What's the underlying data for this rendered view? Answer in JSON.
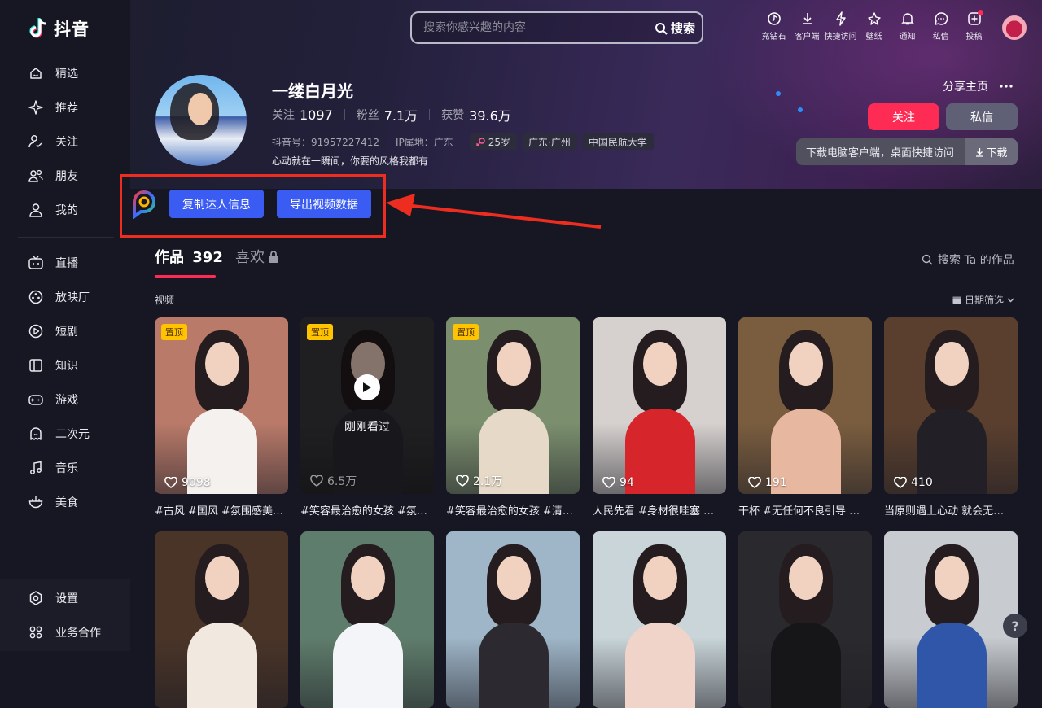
{
  "app": {
    "logo_text": "抖音"
  },
  "sidebar": {
    "items": [
      {
        "label": "精选",
        "icon": "home-smile-icon"
      },
      {
        "label": "推荐",
        "icon": "sparkle-icon"
      },
      {
        "label": "关注",
        "icon": "user-check-icon"
      },
      {
        "label": "朋友",
        "icon": "friends-icon"
      },
      {
        "label": "我的",
        "icon": "person-icon"
      }
    ],
    "items2": [
      {
        "label": "直播",
        "icon": "tv-icon"
      },
      {
        "label": "放映厅",
        "icon": "film-reel-icon"
      },
      {
        "label": "短剧",
        "icon": "play-circle-icon"
      },
      {
        "label": "知识",
        "icon": "book-icon"
      },
      {
        "label": "游戏",
        "icon": "gamepad-icon"
      },
      {
        "label": "二次元",
        "icon": "ghost-icon"
      },
      {
        "label": "音乐",
        "icon": "music-note-icon"
      },
      {
        "label": "美食",
        "icon": "bowl-icon"
      }
    ],
    "bottom": [
      {
        "label": "设置",
        "icon": "settings-icon"
      },
      {
        "label": "业务合作",
        "icon": "grid-icon"
      }
    ]
  },
  "header": {
    "search_placeholder": "搜索你感兴趣的内容",
    "search_button": "搜索",
    "actions": [
      {
        "label": "充钻石",
        "icon": "diamond-icon"
      },
      {
        "label": "客户端",
        "icon": "download-icon"
      },
      {
        "label": "快捷访问",
        "icon": "lightning-icon"
      },
      {
        "label": "壁纸",
        "icon": "star-sparkle-icon"
      },
      {
        "label": "通知",
        "icon": "bell-icon"
      },
      {
        "label": "私信",
        "icon": "chat-icon"
      },
      {
        "label": "投稿",
        "icon": "plus-square-icon"
      }
    ]
  },
  "profile": {
    "name": "一缕白月光",
    "following_label": "关注",
    "following": "1097",
    "fans_label": "粉丝",
    "fans": "7.1万",
    "likes_label": "获赞",
    "likes": "39.6万",
    "douyin_id": "抖音号：91957227412",
    "ip_location": "IP属地：广东",
    "tags": [
      "25岁",
      "广东·广州",
      "中国民航大学"
    ],
    "bio": "心动就在一瞬间，你要的风格我都有",
    "share_label": "分享主页",
    "follow_button": "关注",
    "message_button": "私信",
    "download_text": "下载电脑客户端，桌面快捷访问",
    "download_button": "下载"
  },
  "plugin": {
    "copy_button": "复制达人信息",
    "export_button": "导出视频数据",
    "highlight_color": "#ec2d1f"
  },
  "tabs": {
    "works_label": "作品",
    "works_count": "392",
    "likes_label": "喜欢",
    "search_works": "搜索 Ta 的作品",
    "section_label": "视频",
    "date_filter": "日期筛选"
  },
  "videos": [
    {
      "pinned": "置顶",
      "likes": "9098",
      "caption": "#古风 #国风 #氛围感美…",
      "bg": "#b97a6a",
      "body": "#f4f1ee"
    },
    {
      "pinned": "置顶",
      "likes": "6.5万",
      "caption": "#笑容最治愈的女孩 #氛…",
      "bg": "#3a3a3e",
      "body": "#2a2b33",
      "watched": "刚刚看过"
    },
    {
      "pinned": "置顶",
      "likes": "2.1万",
      "caption": "#笑容最治愈的女孩 #清…",
      "bg": "#7b8f6e",
      "body": "#e6d9c8"
    },
    {
      "pinned": "",
      "likes": "94",
      "caption": "人民先看 #身材很哇塞 …",
      "bg": "#d6d1cf",
      "body": "#d6262c"
    },
    {
      "pinned": "",
      "likes": "191",
      "caption": "干杯 #无任何不良引导 …",
      "bg": "#7a5d3f",
      "body": "#e8b79f"
    },
    {
      "pinned": "",
      "likes": "410",
      "caption": "当原则遇上心动 就会无…",
      "bg": "#5a3f2e",
      "body": "#222026"
    },
    {
      "pinned": "",
      "likes": "",
      "caption": "",
      "bg": "#4a3428",
      "body": "#f1e8e0"
    },
    {
      "pinned": "",
      "likes": "",
      "caption": "",
      "bg": "#5f7d6c",
      "body": "#f3f5f8"
    },
    {
      "pinned": "",
      "likes": "",
      "caption": "",
      "bg": "#9fb6c8",
      "body": "#2c2a30"
    },
    {
      "pinned": "",
      "likes": "",
      "caption": "",
      "bg": "#c9d5d8",
      "body": "#f1d4c9"
    },
    {
      "pinned": "",
      "likes": "",
      "caption": "",
      "bg": "#2a2a2e",
      "body": "#161618"
    },
    {
      "pinned": "",
      "likes": "",
      "caption": "",
      "bg": "#c8ccd0",
      "body": "#2f56a8"
    }
  ],
  "help_icon": "?"
}
